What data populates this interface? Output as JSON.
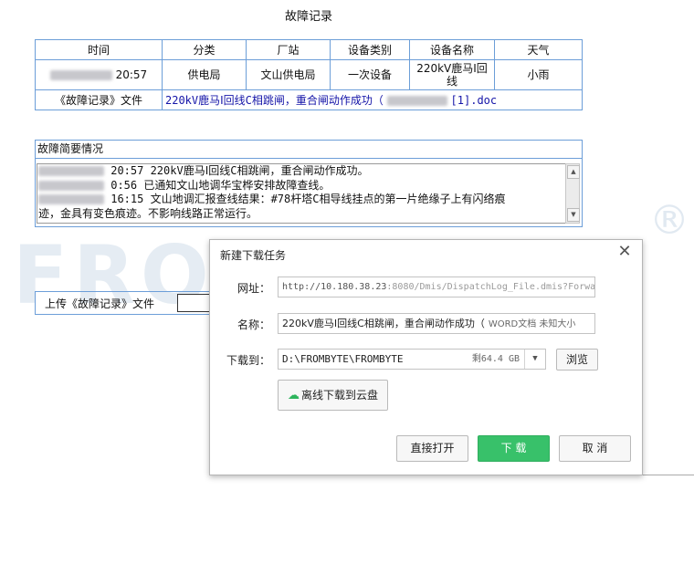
{
  "page": {
    "title": "故障记录"
  },
  "info_table": {
    "headers": [
      "时间",
      "分类",
      "厂站",
      "设备类别",
      "设备名称",
      "天气"
    ],
    "row": {
      "time": "20:57",
      "category": "供电局",
      "station": "文山供电局",
      "device_type": "一次设备",
      "device_name": "220kV鹿马Ⅰ回线",
      "weather": "小雨"
    },
    "file_label": "《故障记录》文件",
    "file_link_prefix": "220kV鹿马Ⅰ回线C相跳闸，重合闸动作成功（",
    "file_link_suffix": "[1].doc"
  },
  "summary": {
    "header": "故障简要情况",
    "lines": [
      "20:57 220kV鹿马Ⅰ回线C相跳闸，重合闸动作成功。",
      "0:56 已通知文山地调华宝桦安排故障查线。",
      "16:15 文山地调汇报查线结果：#78杆塔C相导线挂点的第一片绝缘子上有闪络痕",
      "迹，金具有变色痕迹。不影响线路正常运行。"
    ]
  },
  "upload": {
    "label": "上传《故障记录》文件"
  },
  "watermark": {
    "text": "FROMBYTE",
    "mark": "®"
  },
  "dialog": {
    "title": "新建下载任务",
    "url_label": "网址：",
    "url_host": "http://10.180.38.23",
    "url_rest": ":8080/Dmis/DispatchLog_File.dmis?Forwa",
    "name_label": "名称：",
    "name_value": "220kV鹿马Ⅰ回线C相跳闸，重合闸动作成功（",
    "name_type": "WORD文档 未知大小",
    "path_label": "下载到：",
    "path_value": "D:\\FROMBYTE\\FROMBYTE",
    "path_free": "剩64.4 GB",
    "browse_label": "浏览",
    "cloud_label": "离线下载到云盘",
    "open_label": "直接打开",
    "download_label": "下 载",
    "cancel_label": "取 消"
  }
}
